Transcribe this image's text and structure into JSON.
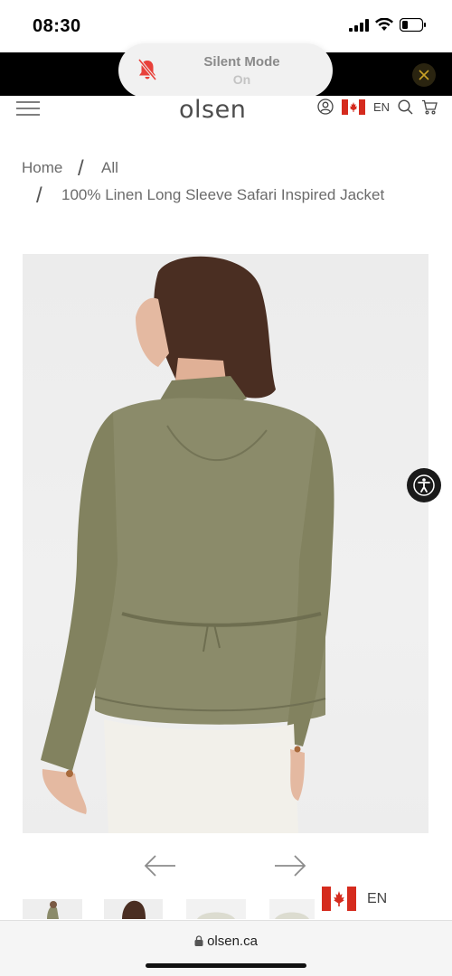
{
  "status_bar": {
    "time": "08:30"
  },
  "notification": {
    "title": "Silent Mode",
    "state": "On"
  },
  "header": {
    "logo": "olsen",
    "language": "EN"
  },
  "breadcrumb": {
    "home": "Home",
    "separator": "/",
    "all": "All",
    "product": "100% Linen Long Sleeve Safari Inspired Jacket"
  },
  "floating_language": {
    "label": "EN"
  },
  "browser": {
    "url": "olsen.ca"
  },
  "colors": {
    "promo_bar": "#000000",
    "jacket": "#8b8b6a",
    "flag_red": "#d52b1e"
  },
  "icons": {
    "menu": "menu-icon",
    "account": "account-icon",
    "flag": "canada-flag-icon",
    "search": "search-icon",
    "cart": "cart-icon",
    "accessibility": "accessibility-icon",
    "prev": "arrow-left-icon",
    "next": "arrow-right-icon",
    "lock": "lock-icon",
    "silent": "bell-slash-icon",
    "close": "close-icon"
  }
}
